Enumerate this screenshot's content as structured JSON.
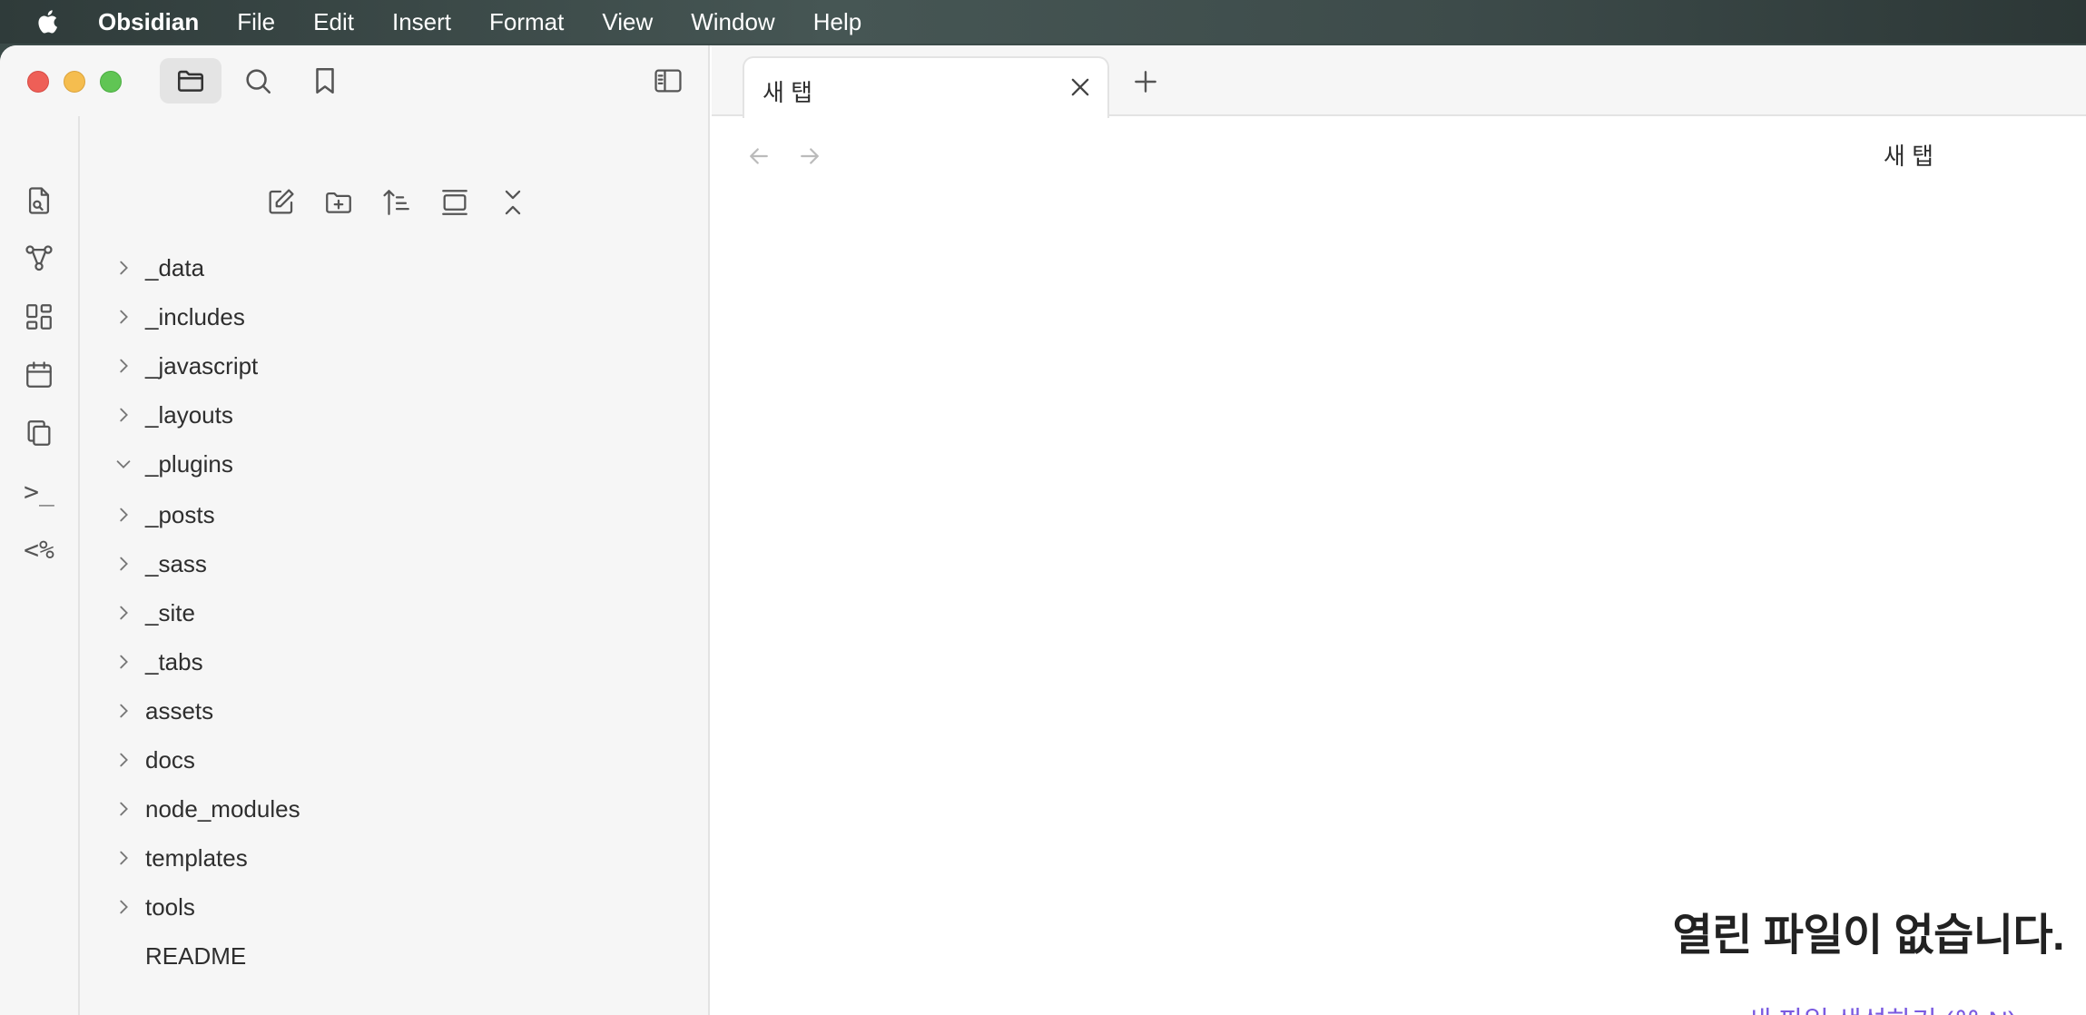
{
  "menubar": {
    "app_name": "Obsidian",
    "items": [
      "File",
      "Edit",
      "Insert",
      "Format",
      "View",
      "Window",
      "Help"
    ]
  },
  "colors": {
    "accent": "#7a5ae0",
    "traffic_red": "#ee5f57",
    "traffic_yellow": "#f5bd4f",
    "traffic_green": "#60c554"
  },
  "titlebar_icons": [
    "folder-icon",
    "search-icon",
    "bookmark-icon",
    "sidebar-toggle-icon"
  ],
  "ribbon_icons": [
    "switcher-icon",
    "graph-icon",
    "canvas-icon",
    "calendar-icon",
    "copy-icon",
    "terminal-icon",
    "templater-icon"
  ],
  "ribbon": {
    "templater_text": "<%",
    "terminal_text": ">_"
  },
  "explorer": {
    "tools": [
      "new-note-icon",
      "new-folder-icon",
      "sort-icon",
      "auto-reveal-icon",
      "collapse-all-icon"
    ],
    "items": [
      {
        "label": "_data",
        "type": "folder",
        "expanded": false
      },
      {
        "label": "_includes",
        "type": "folder",
        "expanded": false
      },
      {
        "label": "_javascript",
        "type": "folder",
        "expanded": false
      },
      {
        "label": "_layouts",
        "type": "folder",
        "expanded": false
      },
      {
        "label": "_plugins",
        "type": "folder",
        "expanded": true
      },
      {
        "label": "_posts",
        "type": "folder",
        "expanded": false
      },
      {
        "label": "_sass",
        "type": "folder",
        "expanded": false
      },
      {
        "label": "_site",
        "type": "folder",
        "expanded": false
      },
      {
        "label": "_tabs",
        "type": "folder",
        "expanded": false
      },
      {
        "label": "assets",
        "type": "folder",
        "expanded": false
      },
      {
        "label": "docs",
        "type": "folder",
        "expanded": false
      },
      {
        "label": "node_modules",
        "type": "folder",
        "expanded": false
      },
      {
        "label": "templates",
        "type": "folder",
        "expanded": false
      },
      {
        "label": "tools",
        "type": "folder",
        "expanded": false
      },
      {
        "label": "README",
        "type": "file",
        "expanded": false
      }
    ]
  },
  "tabs": [
    {
      "label": "새 탭"
    }
  ],
  "view": {
    "title": "새 탭",
    "empty_title": "열린 파일이 없습니다.",
    "create_file_label": "새 파일 생성하기 (⌘ N)"
  }
}
